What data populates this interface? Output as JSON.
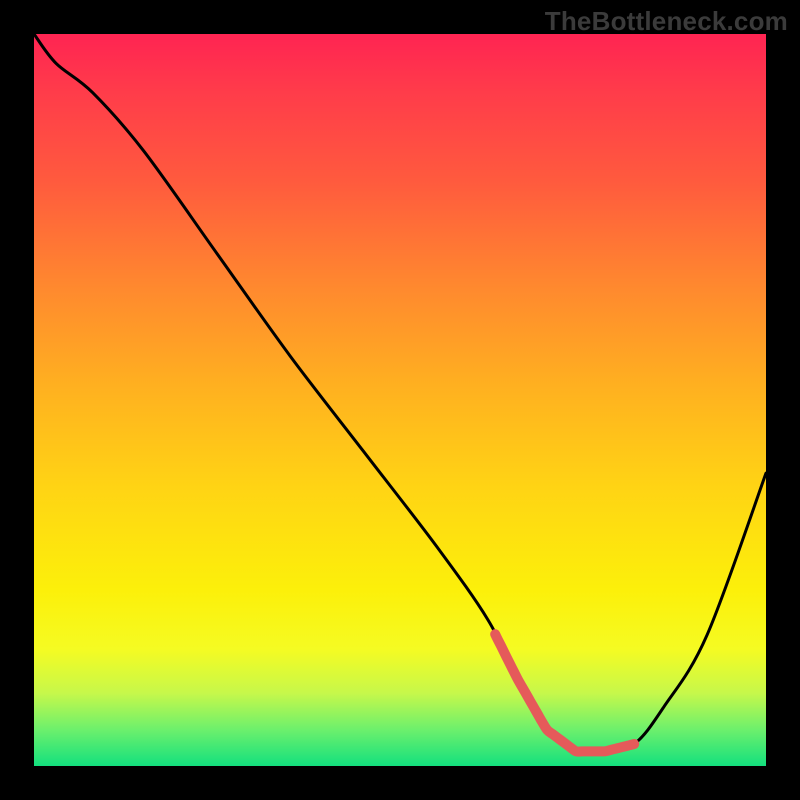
{
  "watermark": "TheBottleneck.com",
  "colors": {
    "background": "#000000",
    "curve_main": "#000000",
    "curve_highlight": "#e55a5a",
    "gradient": [
      "#ff2452",
      "#ff3c4a",
      "#ff5a3e",
      "#ff8a2e",
      "#ffb020",
      "#ffd414",
      "#fcf00a",
      "#f5fb22",
      "#c7f84a",
      "#6df06c",
      "#13e07e"
    ]
  },
  "chart_data": {
    "type": "line",
    "title": "",
    "xlabel": "",
    "ylabel": "",
    "xlim": [
      0,
      100
    ],
    "ylim": [
      0,
      100
    ],
    "x": [
      0,
      3,
      8,
      15,
      25,
      35,
      45,
      55,
      62,
      66,
      70,
      74,
      78,
      82,
      86,
      92,
      100
    ],
    "y": [
      100,
      96,
      92,
      84,
      70,
      56,
      43,
      30,
      20,
      12,
      5,
      2,
      2,
      3,
      8,
      18,
      40
    ],
    "highlight_range_x": [
      63,
      82
    ]
  }
}
